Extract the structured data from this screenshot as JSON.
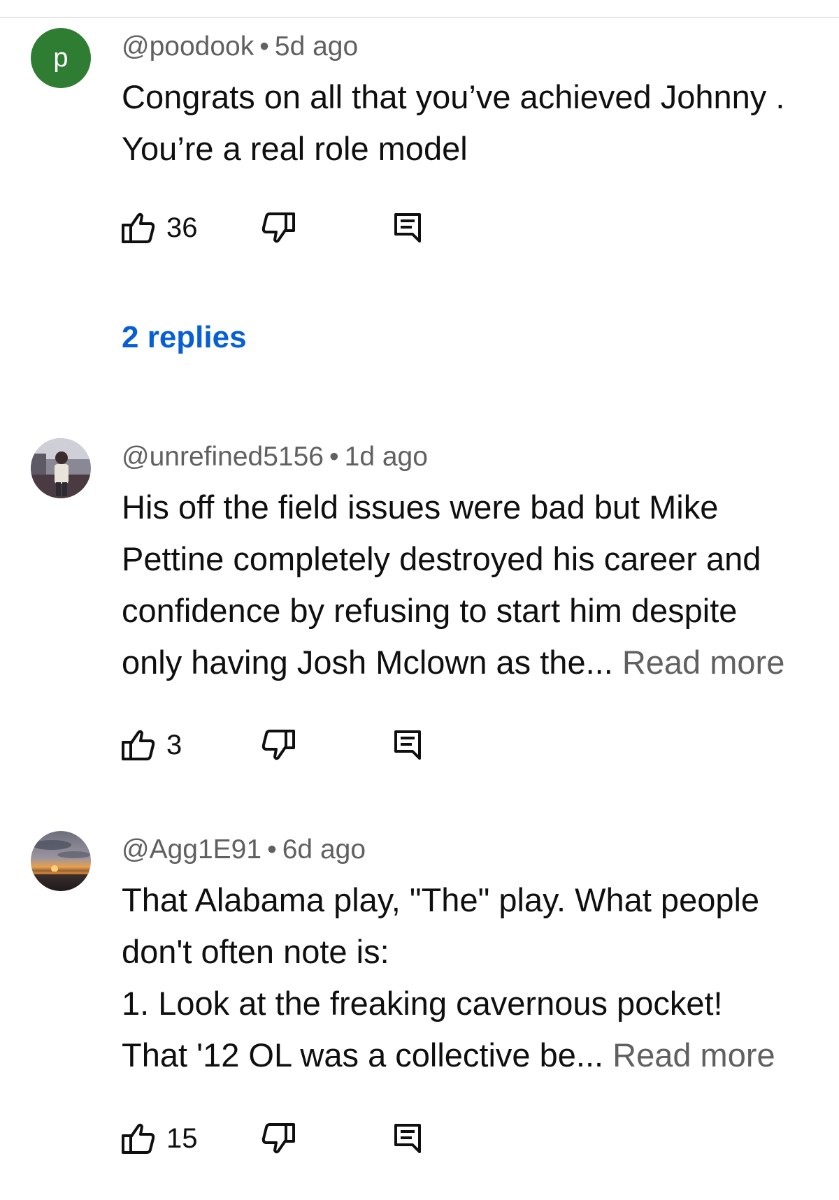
{
  "comments": [
    {
      "avatar_letter": "p",
      "avatar_color": "#2e7d32",
      "author": "@poodook",
      "separator": "•",
      "time": "5d ago",
      "lines": [
        "Congrats on all that you’ve achieved Johnny .",
        "You’re a real role model"
      ],
      "read_more": "",
      "likes": "36",
      "replies_label": "2 replies"
    },
    {
      "avatar_icon": "profile-photo-icon",
      "author": "@unrefined5156",
      "separator": "•",
      "time": "1d ago",
      "lines": [
        "His off the field issues were bad but Mike",
        "Pettine completely destroyed his career and",
        "confidence by refusing to start him despite",
        "only having Josh Mclown as the..."
      ],
      "read_more": "Read more",
      "likes": "3"
    },
    {
      "avatar_icon": "sunset-photo-icon",
      "author": "@Agg1E91",
      "separator": "•",
      "time": "6d ago",
      "lines": [
        "That Alabama play, \"The\" play. What people",
        "don't often note is:",
        "1. Look at the freaking cavernous pocket!",
        "That '12 OL was a collective be..."
      ],
      "read_more": "Read more",
      "likes": "15"
    }
  ],
  "icons": {
    "like": "thumbs-up-icon",
    "dislike": "thumbs-down-icon",
    "reply": "reply-comment-icon"
  },
  "colors": {
    "link_blue": "#065fd4",
    "meta_gray": "#606060",
    "text": "#0f0f0f"
  }
}
